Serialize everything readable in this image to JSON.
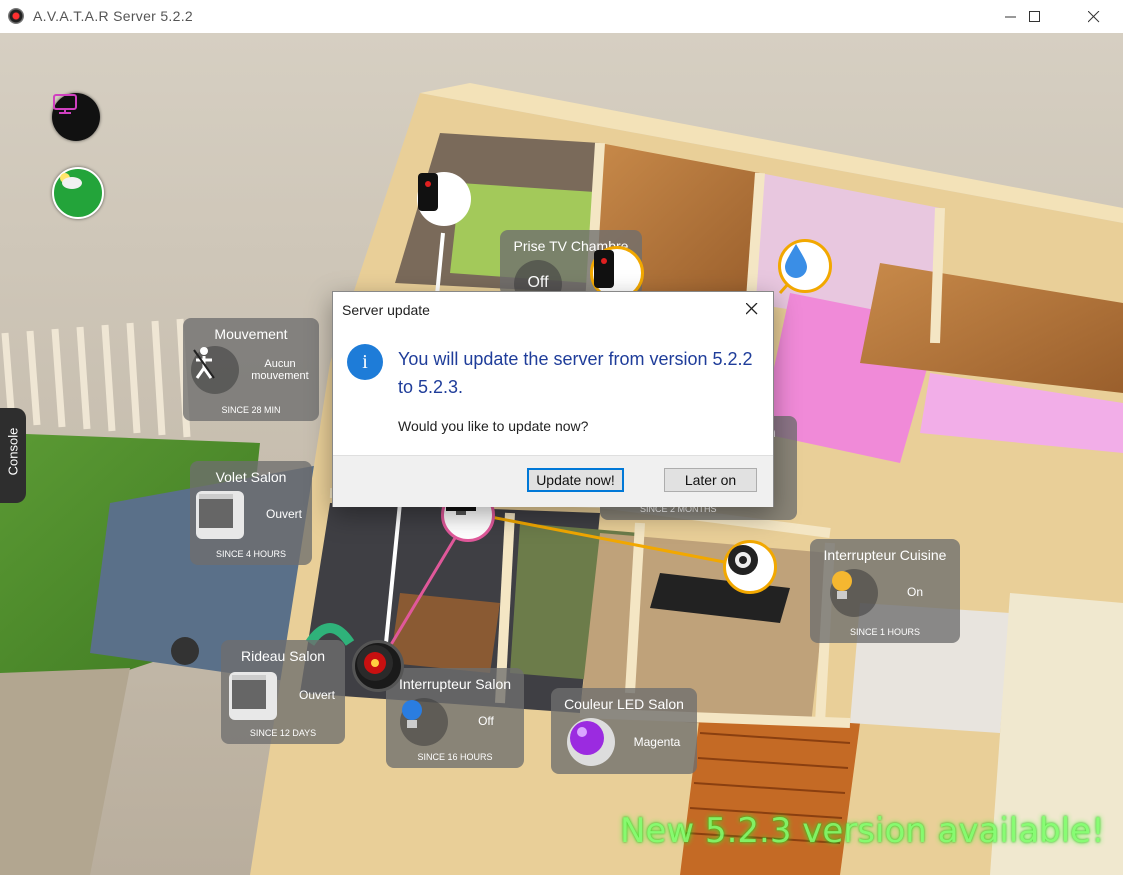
{
  "window": {
    "title": "A.V.A.T.A.R Server 5.2.2",
    "minimize_icon": "minimize-icon",
    "maximize_icon": "maximize-icon",
    "close_icon": "close-icon"
  },
  "side": {
    "console_label": "Console",
    "monitor_icon": "monitor-icon",
    "weather_icon": "weather-icon"
  },
  "widgets": {
    "mouvement": {
      "title": "Mouvement",
      "state": "Aucun mouvement",
      "since": "SINCE 28 MIN"
    },
    "volet_salon": {
      "title": "Volet Salon",
      "state": "Ouvert",
      "since": "SINCE 4 HOURS"
    },
    "rideau_salon": {
      "title": "Rideau Salon",
      "state": "Ouvert",
      "since": "SINCE 12 DAYS"
    },
    "interrupteur_salon": {
      "title": "Interrupteur Salon",
      "state": "Off",
      "since": "SINCE 16 HOURS"
    },
    "couleur_led_salon": {
      "title": "Couleur LED Salon",
      "state": "Magenta"
    },
    "interrupteur_cuisine": {
      "title": "Interrupteur Cuisine",
      "state": "On",
      "since": "SINCE 1 HOURS"
    },
    "prise_tv_chambre": {
      "title": "Prise TV Chambre",
      "state": "Off"
    },
    "hidden_partial": {
      "title_fragment": "on",
      "since": "SINCE 2 MONTHS"
    }
  },
  "dialog": {
    "title": "Server update",
    "message": "You will update the server from version 5.2.2 to 5.2.3.",
    "question": "Would you like to update now?",
    "primary_button": "Update now!",
    "secondary_button": "Later on",
    "info_icon": "info-icon"
  },
  "banner": {
    "text": "New 5.2.3 version available!"
  },
  "colors": {
    "accent_orange": "#f2a800",
    "accent_pink": "#e0589a",
    "dialog_text_blue": "#1f3d9a",
    "banner_green": "#7dff6b"
  }
}
